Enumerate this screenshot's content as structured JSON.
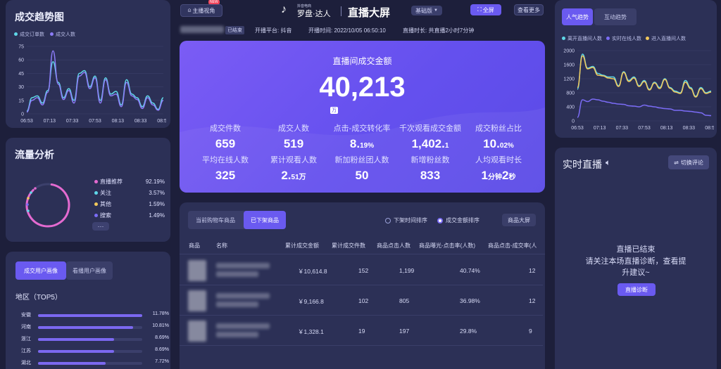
{
  "header": {
    "host_badge": "NEW",
    "host_button": "主播视角",
    "brand_small": "抖音电商",
    "brand_name": "罗盘·达人",
    "screen_title": "直播大屏",
    "edition": "基础版",
    "fullscreen": "全屏",
    "more": "查看更多",
    "status_tag": "已结束",
    "platform": "开播平台: 抖音",
    "start_time": "开播时间: 2022/10/05 06:50:10",
    "duration": "直播时长: 共直播2小时7分钟"
  },
  "trend": {
    "title": "成交趋势图",
    "legend": [
      "成交订单数",
      "成交人数"
    ],
    "y_ticks": [
      "75",
      "60",
      "45",
      "30",
      "15",
      "0"
    ],
    "x_ticks": [
      "06:53",
      "07:13",
      "07:33",
      "07:53",
      "08:13",
      "08:33",
      "08:53"
    ]
  },
  "traffic": {
    "title": "流量分析",
    "items": [
      {
        "label": "直播推荐",
        "value": "92.19%",
        "color": "#e46ad0"
      },
      {
        "label": "关注",
        "value": "3.57%",
        "color": "#5fd7e8"
      },
      {
        "label": "其他",
        "value": "1.59%",
        "color": "#f2c85b"
      },
      {
        "label": "搜索",
        "value": "1.49%",
        "color": "#7b6cf6"
      }
    ],
    "more": "···"
  },
  "portrait": {
    "tab_active": "成交用户画像",
    "tab_inactive": "看播用户画像",
    "section": "地区（TOP5）",
    "regions": [
      {
        "name": "安徽",
        "value": "11.78%",
        "pct": 100
      },
      {
        "name": "河南",
        "value": "10.81%",
        "pct": 91
      },
      {
        "name": "浙江",
        "value": "8.69%",
        "pct": 73
      },
      {
        "name": "江苏",
        "value": "8.69%",
        "pct": 73
      },
      {
        "name": "湖北",
        "value": "7.72%",
        "pct": 65
      }
    ]
  },
  "hero": {
    "title": "直播间成交金额",
    "amount": "40,213",
    "unit": "万",
    "metrics": [
      {
        "label": "成交件数",
        "value": "659",
        "suffix": ""
      },
      {
        "label": "成交人数",
        "value": "519",
        "suffix": ""
      },
      {
        "label": "点击-成交转化率",
        "value": "8.",
        "suffix": "19%"
      },
      {
        "label": "千次观看成交金额",
        "value": "1,402.",
        "suffix": "1"
      },
      {
        "label": "成交粉丝占比",
        "value": "10.",
        "suffix": "02%"
      },
      {
        "label": "平均在线人数",
        "value": "325",
        "suffix": ""
      },
      {
        "label": "累计观看人数",
        "value": "2.",
        "suffix": "51万"
      },
      {
        "label": "新加粉丝团人数",
        "value": "50",
        "suffix": ""
      },
      {
        "label": "新增粉丝数",
        "value": "833",
        "suffix": ""
      },
      {
        "label": "人均观看时长",
        "value": "1",
        "suffix": "分钟",
        "value2": "2",
        "suffix2": "秒"
      }
    ]
  },
  "products": {
    "tab_inactive": "当前购物车商品",
    "tab_active": "已下架商品",
    "radio1": "下架时间排序",
    "radio2": "成交金额排序",
    "big_screen": "商品大屏",
    "columns": [
      "商品",
      "名称",
      "累计成交金额",
      "累计成交件数",
      "商品点击人数",
      "商品曝光-点击率(人数)",
      "商品点击-成交率(人"
    ],
    "rows": [
      {
        "amount": "￥10,614.8",
        "count": "152",
        "clicks": "1,199",
        "rate": "40.74%",
        "rate2": "12"
      },
      {
        "amount": "￥9,166.8",
        "count": "102",
        "clicks": "805",
        "rate": "36.98%",
        "rate2": "12"
      },
      {
        "amount": "￥1,328.1",
        "count": "19",
        "clicks": "197",
        "rate": "29.8%",
        "rate2": "9"
      }
    ]
  },
  "popularity": {
    "tab_active": "人气趋势",
    "tab_inactive": "互动趋势",
    "legend": [
      "离开直播间人数",
      "实时在线人数",
      "进入直播间人数"
    ],
    "y_ticks": [
      "2000",
      "1600",
      "1200",
      "800",
      "400",
      "0"
    ],
    "x_ticks": [
      "06:53",
      "07:13",
      "07:33",
      "07:53",
      "08:13",
      "08:33",
      "08:53"
    ]
  },
  "live": {
    "title": "实时直播",
    "switch": "切换评论",
    "ended": "直播已结束",
    "hint1": "请关注本场直播诊断，查看提",
    "hint2": "升建议~",
    "diagnose": "直播诊断"
  },
  "chart_data": [
    {
      "type": "line",
      "title": "成交趋势图",
      "x": [
        "06:53",
        "07:13",
        "07:33",
        "07:53",
        "08:13",
        "08:33",
        "08:53"
      ],
      "ylim": [
        0,
        75
      ],
      "series": [
        {
          "name": "成交订单数",
          "color": "#5fd7e8",
          "values": [
            3,
            18,
            20,
            12,
            26,
            58,
            35,
            18,
            28,
            15,
            45,
            48,
            30,
            42,
            15,
            40,
            22,
            25,
            10,
            38,
            22,
            18,
            8,
            20,
            12,
            5,
            18
          ]
        },
        {
          "name": "成交人数",
          "color": "#8c7cf7",
          "values": [
            2,
            15,
            18,
            10,
            24,
            70,
            33,
            16,
            26,
            12,
            42,
            46,
            28,
            40,
            12,
            38,
            20,
            22,
            8,
            35,
            20,
            16,
            6,
            18,
            10,
            4,
            15
          ]
        }
      ]
    },
    {
      "type": "pie",
      "title": "流量分析",
      "categories": [
        "直播推荐",
        "关注",
        "其他",
        "搜索"
      ],
      "values": [
        92.19,
        3.57,
        1.59,
        1.49
      ]
    },
    {
      "type": "line",
      "title": "人气趋势",
      "x": [
        "06:53",
        "07:13",
        "07:33",
        "07:53",
        "08:13",
        "08:33",
        "08:53"
      ],
      "ylim": [
        0,
        2000
      ],
      "series": [
        {
          "name": "离开直播间人数",
          "color": "#5fd7e8",
          "values": [
            900,
            1900,
            1500,
            1550,
            1350,
            1300,
            1250,
            1250,
            1000,
            1400,
            1150,
            1250,
            1000,
            1150,
            900,
            1100,
            950,
            1200,
            950,
            850,
            800,
            1150,
            950,
            700,
            950,
            800,
            850
          ]
        },
        {
          "name": "实时在线人数",
          "color": "#7b6cf6",
          "values": [
            100,
            600,
            550,
            620,
            600,
            560,
            530,
            500,
            480,
            470,
            430,
            420,
            400,
            450,
            420,
            400,
            370,
            350,
            340,
            300,
            300,
            280,
            270,
            250,
            230,
            160,
            150
          ]
        },
        {
          "name": "进入直播间人数",
          "color": "#f2c85b",
          "values": [
            950,
            1850,
            1480,
            1520,
            1300,
            1280,
            1220,
            1200,
            980,
            1380,
            1120,
            1220,
            980,
            1120,
            880,
            1080,
            920,
            1180,
            930,
            820,
            780,
            1100,
            920,
            680,
            920,
            780,
            820
          ]
        }
      ]
    }
  ]
}
